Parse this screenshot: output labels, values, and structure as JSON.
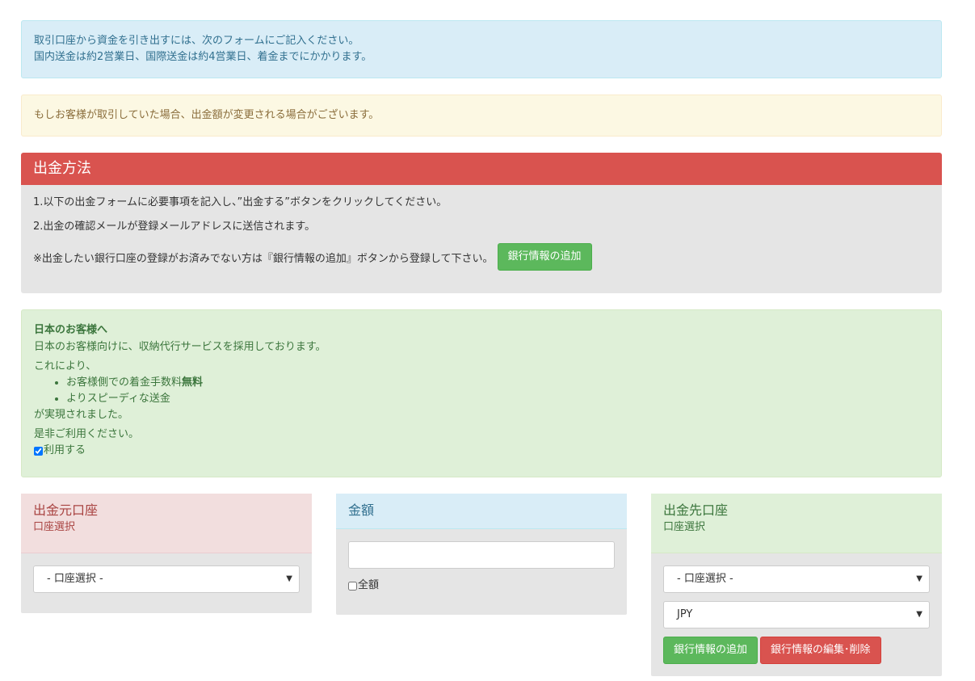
{
  "info_alert": {
    "line1": "取引口座から資金を引き出すには、次のフォームにご記入ください。",
    "line2": "国内送金は約2営業日、国際送金は約4営業日、着金までにかかります。"
  },
  "warning_alert": {
    "text": "もしお客様が取引していた場合、出金額が変更される場合がございます。"
  },
  "method_panel": {
    "title": "出金方法",
    "step1": "1.以下の出金フォームに必要事項を記入し、”出金する”ボタンをクリックしてください。",
    "step2": "2.出金の確認メールが登録メールアドレスに送信されます。",
    "note": "※出金したい銀行口座の登録がお済みでない方は『銀行情報の追加』ボタンから登録して下さい。",
    "add_bank_button": "銀行情報の追加"
  },
  "japan_alert": {
    "title": "日本のお客様へ",
    "intro": "日本のお客様向けに、収納代行サービスを採用しております。",
    "lead": "これにより、",
    "bullet1_text": "お客様側での着金手数料",
    "bullet1_bold": "無料",
    "bullet2": "よりスピーディな送金",
    "result": "が実現されました。",
    "closing": "是非ご利用ください。",
    "use_checkbox_label": "利用する",
    "use_checked": true
  },
  "source_account": {
    "title": "出金元口座",
    "subtitle": "口座選択",
    "select_value": "- 口座選択 -"
  },
  "amount": {
    "title": "金額",
    "input_value": "",
    "all_checkbox_label": "全額",
    "all_checked": false
  },
  "destination_account": {
    "title": "出金先口座",
    "subtitle": "口座選択",
    "select_value": "- 口座選択 -",
    "currency_value": "JPY",
    "add_bank_button": "銀行情報の追加",
    "edit_bank_button": "銀行情報の編集･削除"
  },
  "icons": {
    "select_caret": "▼"
  },
  "colors": {
    "danger": "#d9534f",
    "success": "#5cb85c",
    "info_bg": "#d9edf7",
    "warning_bg": "#fcf8e3",
    "success_bg": "#dff0d8",
    "danger_bg": "#f2dede",
    "panel_body": "#e5e5e5"
  }
}
